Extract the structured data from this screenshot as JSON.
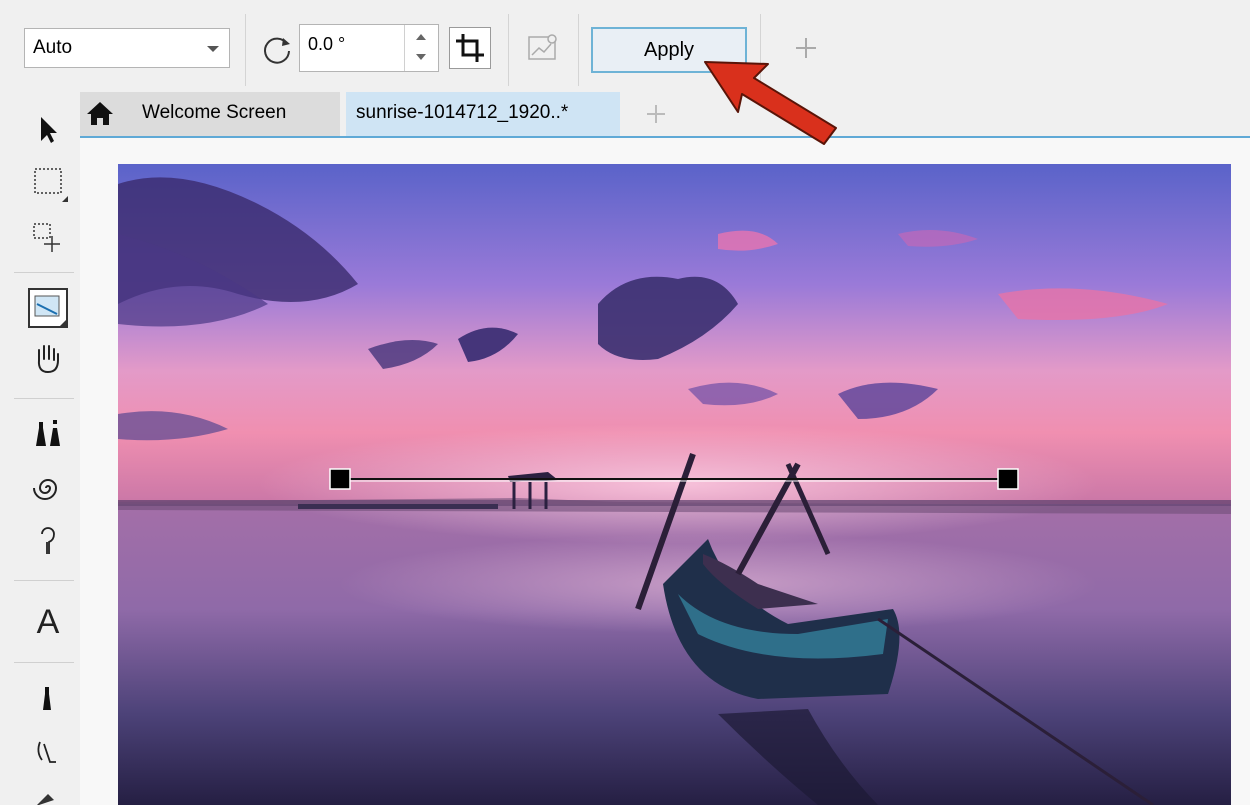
{
  "propbar": {
    "mode_value": "Auto",
    "rotation_value": "0.0 °",
    "apply_label": "Apply"
  },
  "tabs": {
    "welcome_label": "Welcome Screen",
    "file_label": "sunrise-1014712_1920..*"
  },
  "toolbox": {
    "text_tool_glyph": "A"
  },
  "colors": {
    "accent": "#5fa9d6",
    "annotation_arrow": "#d9301c"
  }
}
